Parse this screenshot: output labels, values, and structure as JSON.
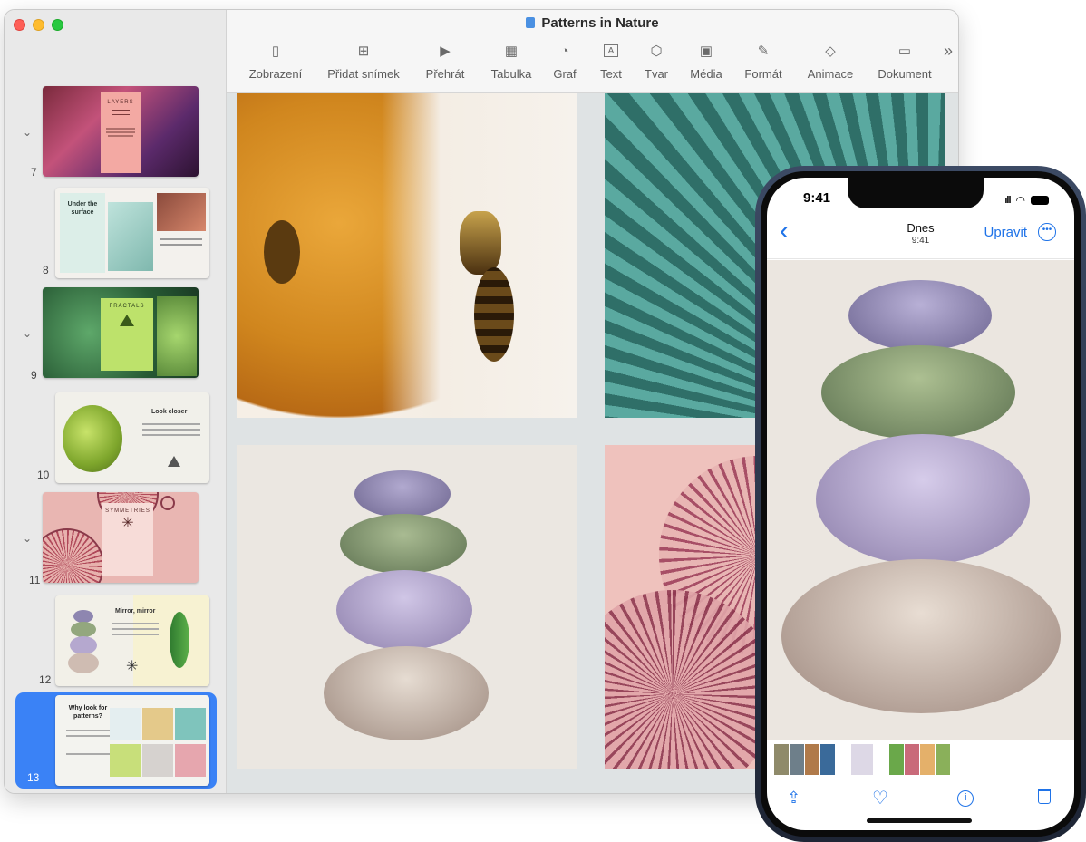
{
  "window": {
    "title": "Patterns in Nature"
  },
  "toolbar": [
    {
      "label": "Zobrazení",
      "icon": "sidebar-view-icon"
    },
    {
      "label": "Přidat snímek",
      "icon": "plus-square-icon"
    },
    {
      "label": "Přehrát",
      "icon": "play-icon"
    },
    {
      "label": "Tabulka",
      "icon": "table-icon"
    },
    {
      "label": "Graf",
      "icon": "chart-icon"
    },
    {
      "label": "Text",
      "icon": "text-box-icon"
    },
    {
      "label": "Tvar",
      "icon": "shape-icon"
    },
    {
      "label": "Média",
      "icon": "media-icon"
    },
    {
      "label": "Formát",
      "icon": "format-brush-icon"
    },
    {
      "label": "Animace",
      "icon": "animate-diamond-icon"
    },
    {
      "label": "Dokument",
      "icon": "document-icon"
    }
  ],
  "toolbar_more": "»",
  "slides": [
    {
      "number": "7",
      "title": "LAYERS",
      "collapsible": true
    },
    {
      "number": "8",
      "title": "Under the surface",
      "collapsible": false
    },
    {
      "number": "9",
      "title": "FRACTALS",
      "collapsible": true
    },
    {
      "number": "10",
      "title": "Look closer",
      "collapsible": false
    },
    {
      "number": "11",
      "title": "SYMMETRIES",
      "collapsible": true
    },
    {
      "number": "12",
      "title": "Mirror, mirror",
      "collapsible": false
    },
    {
      "number": "13",
      "title": "Why look for patterns?",
      "collapsible": false,
      "selected": true
    }
  ],
  "phone": {
    "time": "9:41",
    "nav_title": "Dnes",
    "nav_subtitle": "9:41",
    "edit_label": "Upravit",
    "back_glyph": "‹"
  },
  "colors": {
    "accent": "#3a82f6",
    "ios_blue": "#1f73e8"
  }
}
